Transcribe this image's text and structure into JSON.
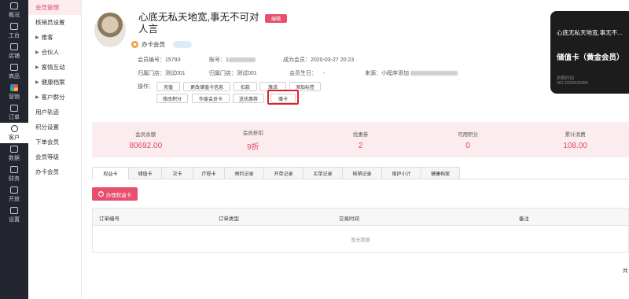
{
  "rail": [
    {
      "label": "概况",
      "icon": "home-icon"
    },
    {
      "label": "工台",
      "icon": "desk-icon"
    },
    {
      "label": "店铺",
      "icon": "shop-icon"
    },
    {
      "label": "商品",
      "icon": "goods-icon"
    },
    {
      "label": "营销",
      "icon": "marketing-icon"
    },
    {
      "label": "订单",
      "icon": "order-icon"
    },
    {
      "label": "客户",
      "icon": "customer-icon"
    },
    {
      "label": "数据",
      "icon": "data-icon"
    },
    {
      "label": "财务",
      "icon": "finance-icon"
    },
    {
      "label": "开放",
      "icon": "open-icon"
    },
    {
      "label": "设置",
      "icon": "settings-icon"
    }
  ],
  "submenu": [
    {
      "label": "会员管理",
      "caret": ""
    },
    {
      "label": "核销员设置",
      "caret": ""
    },
    {
      "label": "推客",
      "caret": "▶"
    },
    {
      "label": "合伙人",
      "caret": "▶"
    },
    {
      "label": "客情互动",
      "caret": "▶"
    },
    {
      "label": "健康档案",
      "caret": "▶"
    },
    {
      "label": "客户群分",
      "caret": "▶"
    },
    {
      "label": "用户轨迹",
      "caret": ""
    },
    {
      "label": "积分设置",
      "caret": ""
    },
    {
      "label": "下单会员",
      "caret": ""
    },
    {
      "label": "会员等级",
      "caret": ""
    },
    {
      "label": "办卡会员",
      "caret": ""
    }
  ],
  "profile": {
    "name": "心底无私天地宽,事无不可对人言",
    "edit_label": "编辑",
    "member_tag": "办卡会员",
    "member_no_label": "会员编号：",
    "member_no": "15793",
    "account_label": "账号：",
    "account_prefix": "1",
    "became_label": "成为会员：",
    "became_date": "2020-03-27 20:23",
    "store1_label": "归属门店：",
    "store1": "测试001",
    "store2_label": "归属门店：",
    "store2": "测试001",
    "birthday_label": "会员生日：",
    "birthday": "-",
    "source_label": "来源：",
    "source": "小程序添加",
    "ops_label": "操作："
  },
  "actions": [
    "充值",
    "更改储值卡信息",
    "扣款",
    "激活",
    "添加标签",
    "修改积分",
    "作废会员卡",
    "送优惠券",
    "赠卡"
  ],
  "card": {
    "subtitle": "心底无私天地宽,事无不...",
    "title": "储值卡（黄金会员）",
    "time_label": "到期时间",
    "number": "NO.2020625859"
  },
  "stats": [
    {
      "label": "会员余额",
      "value": "80692.00"
    },
    {
      "label": "会员折扣",
      "value": "9折"
    },
    {
      "label": "优惠券",
      "value": "2"
    },
    {
      "label": "可用积分",
      "value": "0"
    },
    {
      "label": "累计消费",
      "value": "108.00"
    }
  ],
  "tabs": [
    "权益卡",
    "储值卡",
    "次卡",
    "疗程卡",
    "预约记录",
    "开单记录",
    "买单记录",
    "核销记录",
    "维护小计",
    "健康档案"
  ],
  "primary_button": "办理权益卡",
  "table": {
    "columns": [
      "订单编号",
      "订单类型",
      "交易时间",
      "备注"
    ],
    "empty": "暂无数据"
  },
  "tail_text": "共"
}
